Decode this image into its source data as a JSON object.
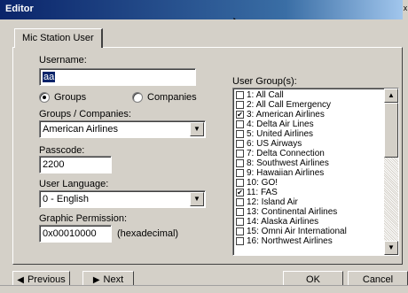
{
  "window": {
    "title": "Editor",
    "edge_glyph": "x"
  },
  "tab": {
    "label": "Mic Station User"
  },
  "form": {
    "username_label": "Username:",
    "username_value": "aa",
    "radio_groups_label": "Groups",
    "radio_companies_label": "Companies",
    "radio_selected": "Groups",
    "groups_companies_label": "Groups / Companies:",
    "groups_companies_value": "American Airlines",
    "passcode_label": "Passcode:",
    "passcode_value": "2200",
    "language_label": "User Language:",
    "language_value": "0 - English",
    "graphic_label": "Graphic Permission:",
    "graphic_value": "0x00010000",
    "graphic_suffix": "(hexadecimal)"
  },
  "user_groups": {
    "label": "User Group(s):",
    "items": [
      {
        "label": "1: All Call",
        "checked": false
      },
      {
        "label": "2: All Call Emergency",
        "checked": false
      },
      {
        "label": "3: American Airlines",
        "checked": true
      },
      {
        "label": "4: Delta Air Lines",
        "checked": false
      },
      {
        "label": "5: United Airlines",
        "checked": false
      },
      {
        "label": "6: US Airways",
        "checked": false
      },
      {
        "label": "7: Delta Connection",
        "checked": false
      },
      {
        "label": "8: Southwest Airlines",
        "checked": false
      },
      {
        "label": "9: Hawaiian Airlines",
        "checked": false
      },
      {
        "label": "10: GO!",
        "checked": false
      },
      {
        "label": "11: FAS",
        "checked": true
      },
      {
        "label": "12: Island Air",
        "checked": false
      },
      {
        "label": "13: Continental Airlines",
        "checked": false
      },
      {
        "label": "14: Alaska Airlines",
        "checked": false
      },
      {
        "label": "15: Omni Air International",
        "checked": false
      },
      {
        "label": "16: Northwest Airlines",
        "checked": false
      }
    ]
  },
  "buttons": {
    "previous": "Previous",
    "next": "Next",
    "ok": "OK",
    "cancel": "Cancel"
  },
  "icons": {
    "check": "✔",
    "arrow_up": "▲",
    "arrow_down": "▼",
    "arrow_left": "◀",
    "arrow_right": "▶"
  }
}
